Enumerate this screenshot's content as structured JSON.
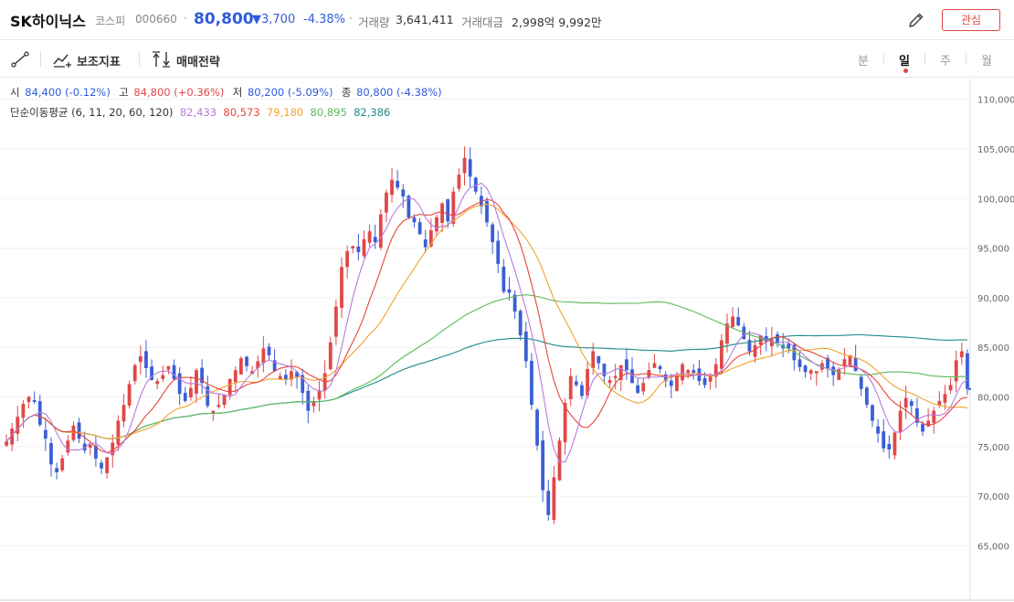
{
  "header": {
    "stock_name": "SK하이닉스",
    "market": "코스피",
    "code": "000660",
    "dot": "·",
    "price": "80,800",
    "change": "▼3,700",
    "change_pct": "-4.38%",
    "volume_label": "거래량",
    "volume_value": "3,641,411",
    "amount_label": "거래대금",
    "amount_value": "2,998억 9,992만",
    "watch_label": "관심"
  },
  "toolbar": {
    "indicator_label": "보조지표",
    "strategy_label": "매매전략",
    "periods": [
      "분",
      "일",
      "주",
      "월"
    ],
    "active_period": "일"
  },
  "ohlc": {
    "open_label": "시",
    "open_value": "84,400 (-0.12%)",
    "high_label": "고",
    "high_value": "84,800 (+0.36%)",
    "low_label": "저",
    "low_value": "80,200 (-5.09%)",
    "close_label": "종",
    "close_value": "80,800 (-4.38%)"
  },
  "ma_legend": {
    "label": "단순이동평균 (6, 11, 20, 60, 120)",
    "values": [
      "82,433",
      "80,573",
      "79,180",
      "80,895",
      "82,386"
    ]
  },
  "colors": {
    "up": "#e04848",
    "down": "#3b5ed6",
    "ma6": "#b57be0",
    "ma11": "#e8453c",
    "ma20": "#f2a32e",
    "ma60": "#5cb85c",
    "ma120": "#1f8a8a"
  },
  "chart_data": {
    "type": "candlestick",
    "y_ticks": [
      "110,000",
      "105,000",
      "100,000",
      "95,000",
      "90,000",
      "85,000",
      "80,000",
      "75,000",
      "70,000",
      "65,000"
    ],
    "ylim": [
      61000,
      111000
    ],
    "last_close": 80800,
    "closes": [
      75500,
      76800,
      78000,
      79300,
      80000,
      79500,
      77200,
      75800,
      73200,
      72400,
      73800,
      75600,
      77100,
      75800,
      74600,
      75200,
      73800,
      72800,
      73900,
      75400,
      77600,
      79200,
      81300,
      83200,
      84100,
      82900,
      81700,
      81600,
      82200,
      83100,
      81800,
      80300,
      79600,
      80900,
      82700,
      81400,
      79100,
      78600,
      79200,
      80200,
      81800,
      82700,
      83900,
      83100,
      82600,
      83600,
      84900,
      84200,
      82600,
      82100,
      81700,
      82600,
      82000,
      80400,
      78600,
      79500,
      80600,
      82400,
      85500,
      89100,
      93100,
      94700,
      95200,
      94600,
      95900,
      96700,
      95600,
      98400,
      100600,
      101900,
      101100,
      100200,
      98100,
      97600,
      96400,
      95100,
      96800,
      98100,
      99500,
      97700,
      100700,
      102400,
      104100,
      102200,
      100700,
      99200,
      97600,
      95600,
      93400,
      90600,
      90500,
      88600,
      86200,
      83600,
      79200,
      75100,
      70600,
      68100,
      71900,
      75600,
      79400,
      82100,
      81200,
      80100,
      82800,
      84600,
      83400,
      82100,
      81700,
      82100,
      83200,
      82700,
      81400,
      80400,
      81400,
      82700,
      83400,
      82800,
      81600,
      81100,
      82100,
      83300,
      82700,
      82400,
      81600,
      81200,
      82100,
      83300,
      85700,
      87400,
      88100,
      87200,
      85800,
      84600,
      85200,
      86200,
      85600,
      85800,
      85400,
      84900,
      84900,
      83700,
      83000,
      82500,
      82700,
      82600,
      83400,
      82900,
      82200,
      82800,
      83800,
      84200,
      82600,
      80800,
      79200,
      77600,
      76300,
      74800,
      74700,
      76400,
      78600,
      79900,
      79100,
      77400,
      76500,
      77600,
      78600,
      79600,
      80300,
      81200,
      83700,
      84600,
      80800
    ]
  }
}
